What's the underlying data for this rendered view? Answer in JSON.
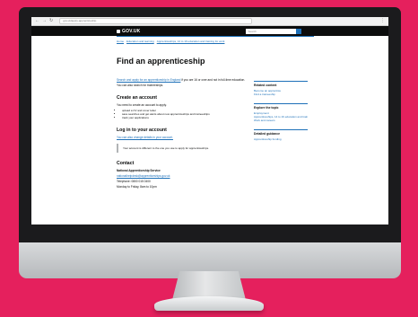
{
  "browser": {
    "url": "gov.uk/apply-apprenticeship"
  },
  "header": {
    "logo": "GOV.UK",
    "search_placeholder": "Search"
  },
  "breadcrumbs": [
    "Home",
    "Education and learning",
    "Apprenticeships, 14 to 19 education and training for work"
  ],
  "main": {
    "title": "Find an apprenticeship",
    "intro_link": "Search and apply for an apprenticeship in England",
    "intro_text": "if you are 16 or over and not in full-time education.",
    "intro_more": "You can also search for traineeships.",
    "create_heading": "Create an account",
    "create_text": "You need to create an account to apply.",
    "create_list": [
      "upload a CV and cover letter",
      "save searches and get alerts about new apprenticeships and traineeships",
      "track your applications"
    ],
    "login_heading": "Log in to your account",
    "login_text": "You can also change details in your account.",
    "inset_text": "Your account is different to the one you use to apply for apprenticeships.",
    "contact_heading": "Contact",
    "contact_subheading": "National Apprenticeship Service",
    "contact_lines": [
      "nationalhelpdesk@apprenticeships.gov.uk",
      "Telephone: 0800 015 0400",
      "Monday to Friday, 8am to 10pm"
    ]
  },
  "sidebar": {
    "related_title": "Related content",
    "related_links": [
      "Become an apprentice",
      "Find a traineeship"
    ],
    "explore_title": "Explore the topic",
    "explore_links": [
      "Employment",
      "Apprenticeships, 14 to 19 education and training for work",
      "Work and careers"
    ],
    "dept_title": "Detailed guidance",
    "dept_links": [
      "Apprenticeship funding"
    ]
  }
}
